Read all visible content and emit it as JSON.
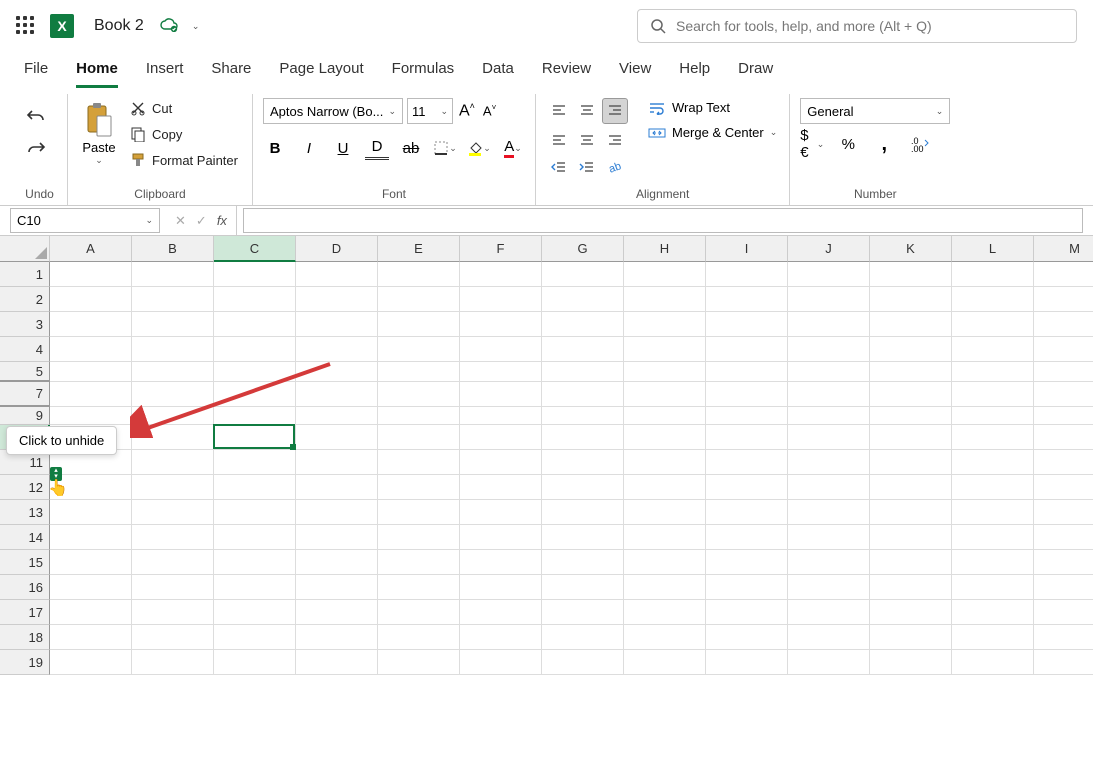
{
  "title_bar": {
    "doc_title": "Book 2",
    "search_placeholder": "Search for tools, help, and more (Alt + Q)"
  },
  "ribbon_tabs": [
    "File",
    "Home",
    "Insert",
    "Share",
    "Page Layout",
    "Formulas",
    "Data",
    "Review",
    "View",
    "Help",
    "Draw"
  ],
  "active_tab": "Home",
  "ribbon": {
    "undo_label": "Undo",
    "clipboard": {
      "paste": "Paste",
      "cut": "Cut",
      "copy": "Copy",
      "format_painter": "Format Painter",
      "group_label": "Clipboard"
    },
    "font": {
      "font_name": "Aptos Narrow (Bo...",
      "font_size": "11",
      "group_label": "Font"
    },
    "alignment": {
      "wrap_text": "Wrap Text",
      "merge_center": "Merge & Center",
      "group_label": "Alignment"
    },
    "number": {
      "format": "General",
      "group_label": "Number"
    }
  },
  "name_box": "C10",
  "columns": [
    "A",
    "B",
    "C",
    "D",
    "E",
    "F",
    "G",
    "H",
    "I",
    "J",
    "K",
    "L",
    "M"
  ],
  "rows": [
    1,
    2,
    3,
    4,
    5,
    7,
    9,
    10,
    11,
    12,
    13,
    14,
    15,
    16,
    17,
    18,
    19
  ],
  "selected_column": "C",
  "selected_row": 10,
  "tooltip_text": "Click to unhide",
  "hidden_boundary_after": 5,
  "hidden_boundary_after2": 7
}
